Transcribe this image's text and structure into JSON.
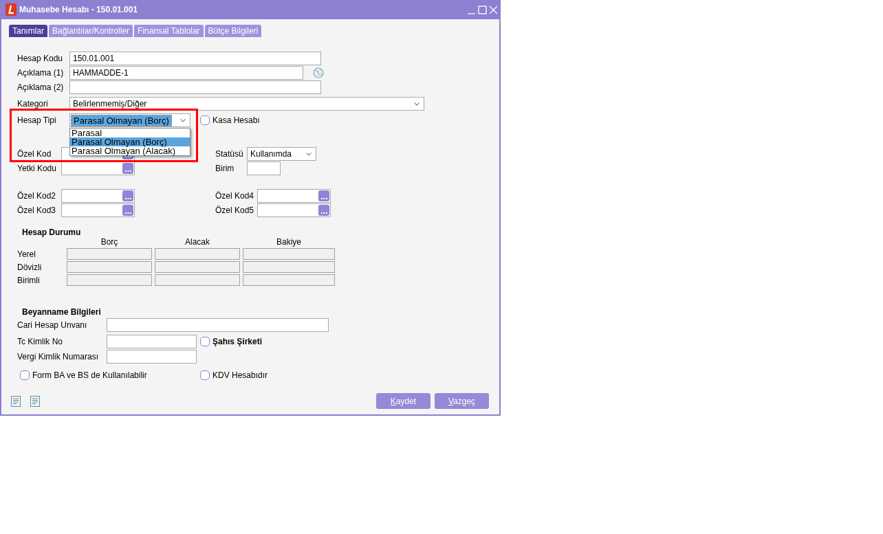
{
  "window": {
    "title": "Muhasebe Hesabı - 150.01.001"
  },
  "tabs": [
    {
      "label": "Tanımlar",
      "selected": true
    },
    {
      "label": "Bağlantılar/Kontroller",
      "selected": false
    },
    {
      "label": "Finansal Tablolar",
      "selected": false
    },
    {
      "label": "Bütçe Bilgileri",
      "selected": false
    }
  ],
  "general": [
    {
      "label": "Hesap Kodu",
      "value": "150.01.001",
      "kind": "text"
    },
    {
      "label": "Açıklama (1)",
      "value": "HAMMADDE-1",
      "kind": "text-globe"
    },
    {
      "label": "Açıklama (2)",
      "kind": "text"
    },
    {
      "label": "Kategori",
      "value": "Belirlenmemiş/Diğer",
      "kind": "select"
    }
  ],
  "account_type": {
    "label": "Hesap Tipi",
    "value": "Parasal Olmayan (Borç)",
    "expanded": true,
    "highlighted": true,
    "options": [
      {
        "label": "Parasal",
        "selected": false
      },
      {
        "label": "Parasal Olmayan (Borç)",
        "selected": true
      },
      {
        "label": "Parasal Olmayan (Alacak)",
        "selected": false
      }
    ]
  },
  "cash_account": {
    "label": "Kasa Hesabı",
    "checked": false
  },
  "code_blocks": [
    {
      "left": [
        {
          "label": "Özel Kod",
          "kind": "lookup"
        },
        {
          "label": "Yetki Kodu",
          "kind": "lookup"
        }
      ],
      "right": [
        {
          "label": "Statüsü",
          "value": "Kullanımda",
          "kind": "select"
        },
        {
          "label": "Birim",
          "kind": "text"
        }
      ]
    },
    {
      "left": [
        {
          "label": "Özel Kod2",
          "kind": "lookup"
        },
        {
          "label": "Özel Kod3",
          "kind": "lookup"
        }
      ],
      "right": [
        {
          "label": "Özel Kod4",
          "kind": "lookup"
        },
        {
          "label": "Özel Kod5",
          "kind": "lookup"
        }
      ]
    }
  ],
  "balance": {
    "title": "Hesap Durumu",
    "columns": [
      "Borç",
      "Alacak",
      "Bakiye"
    ],
    "rows": [
      "Yerel",
      "Dövizli",
      "Birimli"
    ]
  },
  "declaration": {
    "title": "Beyanname Bilgileri",
    "fields": [
      {
        "label": "Cari Hesap Unvanı",
        "kind": "wide"
      },
      {
        "label": "Tc Kimlik No",
        "kind": "short",
        "check": {
          "label": "Şahıs Şirketi",
          "checked": false
        }
      },
      {
        "label": "Vergi Kimlik Numarası",
        "kind": "short"
      }
    ],
    "checks": [
      {
        "label": "Form BA ve BS de Kullanılabilir",
        "checked": false
      },
      {
        "label": "KDV Hesabıdır",
        "checked": false
      }
    ]
  },
  "buttons": [
    "Kaydet",
    "Vazgeç"
  ]
}
